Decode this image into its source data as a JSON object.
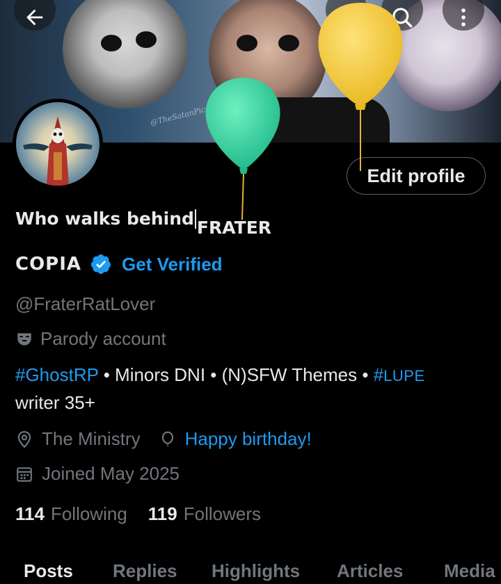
{
  "header": {
    "back_icon": "arrow-left-icon",
    "grok_icon": "grok-icon",
    "search_icon": "search-icon",
    "more_icon": "more-vertical-icon",
    "banner_watermark": "@TheSatanPics"
  },
  "profile": {
    "edit_profile_label": "Edit profile",
    "name_line1": "Who walks behind",
    "name_line1_tail": "FRATER",
    "name_line2": "COPIA",
    "get_verified_label": "Get Verified",
    "handle": "@FraterRatLover",
    "parody_label": "Parody account",
    "bio": {
      "tag1": "#GhostRP",
      "text1": " • Minors DNI • (N)SFW Themes • ",
      "tag2_hash": "#",
      "tag2_word": "LUPE",
      "text2": "writer 35+"
    },
    "location": "The Ministry",
    "birthday_label": "Happy birthday!",
    "joined": "Joined May 2025",
    "following_count": "114",
    "following_label": "Following",
    "followers_count": "119",
    "followers_label": "Followers"
  },
  "tabs": [
    "Posts",
    "Replies",
    "Highlights",
    "Articles",
    "Media"
  ],
  "colors": {
    "accent": "#1d9bf0",
    "background": "#000000",
    "muted_text": "#71767b",
    "balloon_green": "#2fd39a",
    "balloon_yellow": "#f2c935"
  }
}
